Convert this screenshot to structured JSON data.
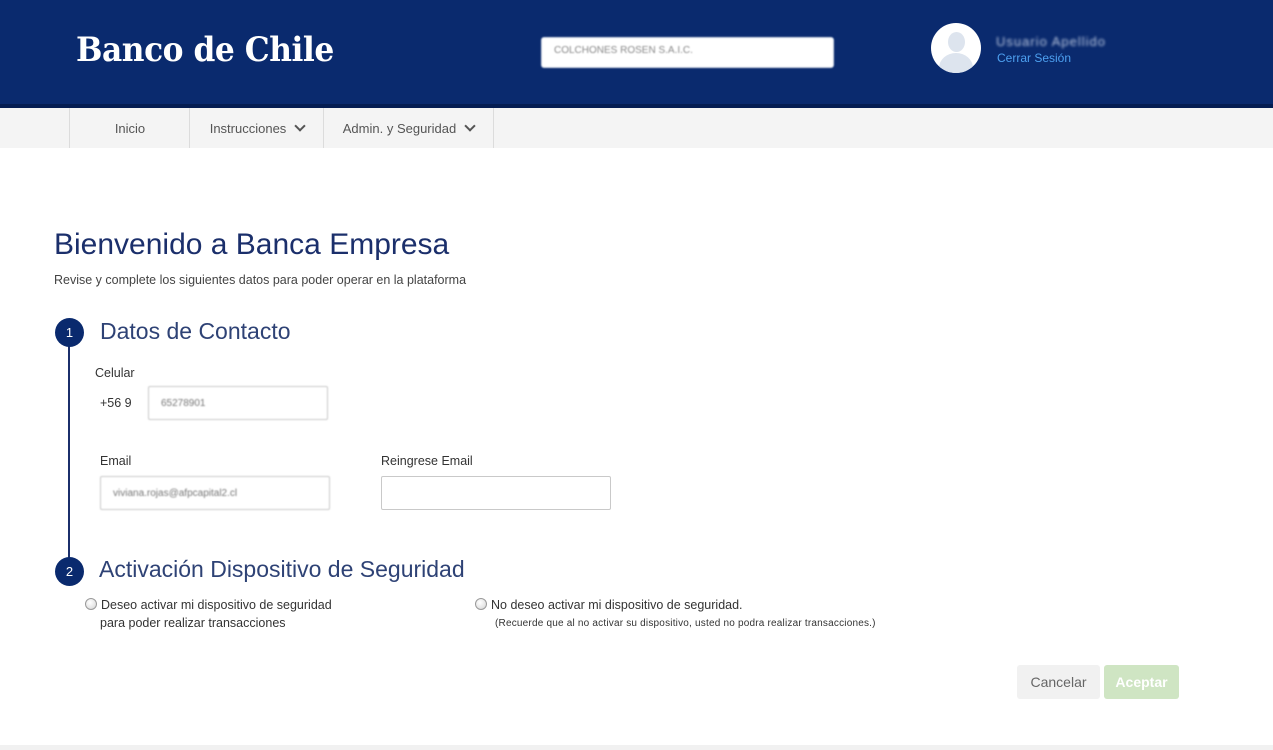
{
  "header": {
    "logo_text": "Banco de Chile",
    "company_selector_value": "COLCHONES ROSEN S.A.I.C.",
    "user_name": "Usuario Apellido",
    "logout_label": "Cerrar Sesión"
  },
  "nav": {
    "items": [
      {
        "label": "Inicio",
        "has_dropdown": false
      },
      {
        "label": "Instrucciones",
        "has_dropdown": true
      },
      {
        "label": "Admin. y Seguridad",
        "has_dropdown": true
      }
    ]
  },
  "main": {
    "title": "Bienvenido a Banca Empresa",
    "subtitle": "Revise y complete los siguientes datos para poder operar en la plataforma",
    "step1": {
      "number": "1",
      "title": "Datos de Contacto",
      "celular_label": "Celular",
      "celular_prefix": "+56 9",
      "celular_value": "65278901",
      "email_label": "Email",
      "email_value": "viviana.rojas@afpcapital2.cl",
      "reemail_label": "Reingrese Email",
      "reemail_value": ""
    },
    "step2": {
      "number": "2",
      "title": "Activación Dispositivo de Seguridad",
      "option_yes_line1": "Deseo activar mi dispositivo de seguridad",
      "option_yes_line2": "para poder realizar transacciones",
      "option_no_line1": "No deseo activar mi dispositivo de seguridad.",
      "option_no_note": "(Recuerde que al no activar su dispositivo, usted no podra realizar transacciones.)"
    },
    "buttons": {
      "cancel_label": "Cancelar",
      "accept_label": "Aceptar"
    }
  },
  "colors": {
    "header_bg": "#0a2a6e",
    "primary_text": "#1b2f6b",
    "link": "#4da0f0",
    "accept_disabled": "#cfe5c3"
  }
}
